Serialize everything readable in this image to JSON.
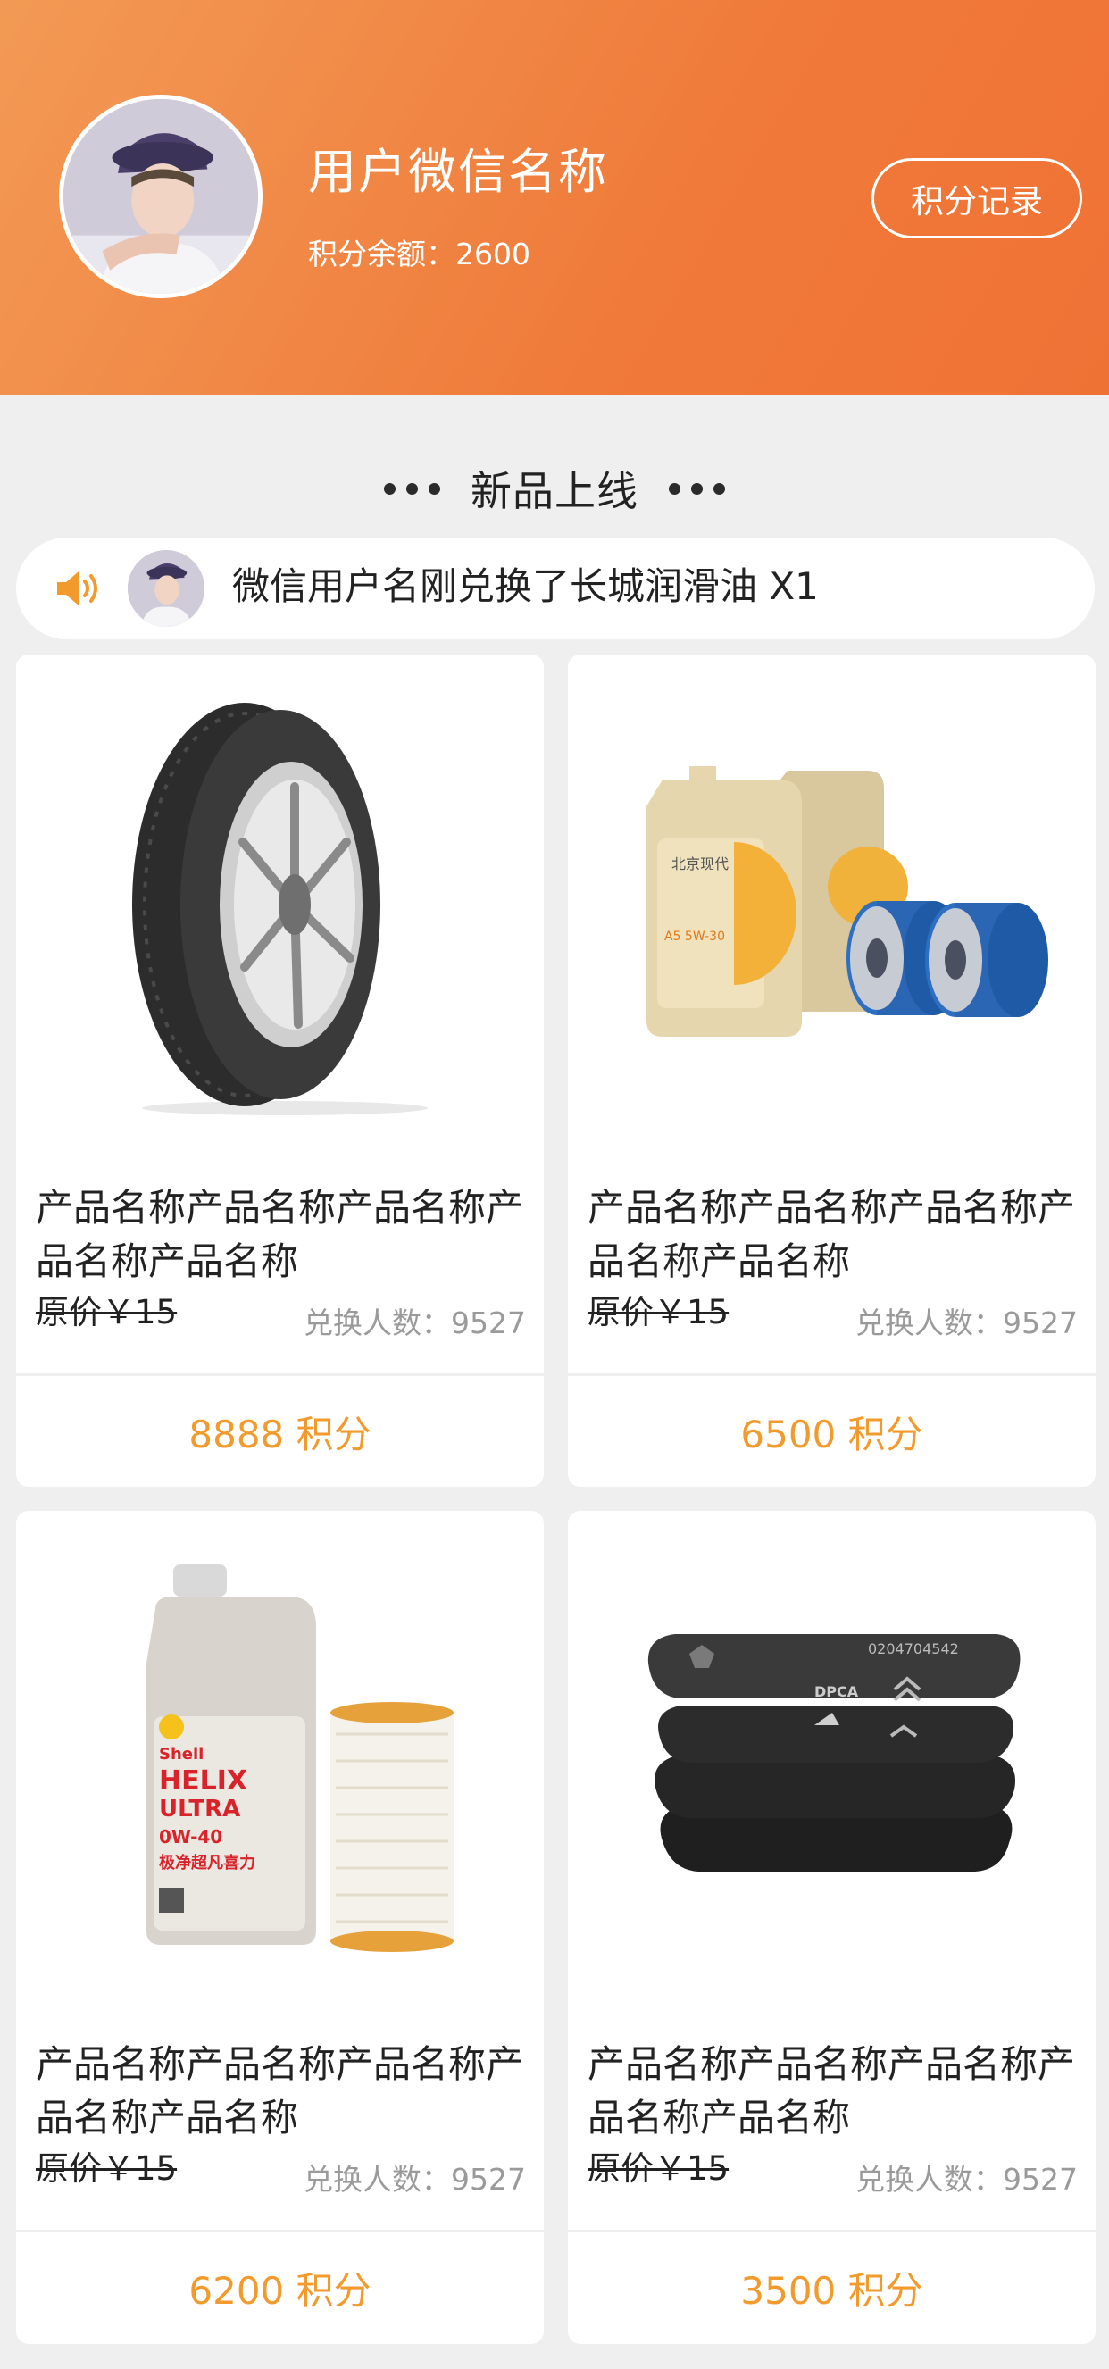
{
  "header": {
    "user_name": "用户微信名称",
    "points_label": "积分余额：",
    "points_value": "2600",
    "records_button": "积分记录"
  },
  "section": {
    "title": "新品上线"
  },
  "ticker": {
    "text": "微信用户名刚兑换了长城润滑油 X1"
  },
  "products": [
    {
      "image": "tire-icon",
      "name": "产品名称产品名称产品名称产品名称产品名称",
      "original_price": "原价￥15",
      "redeem_count": "兑换人数：9527",
      "points_price": "8888 积分"
    },
    {
      "image": "engine-oil-and-filters-icon",
      "name": "产品名称产品名称产品名称产品名称产品名称",
      "original_price": "原价￥15",
      "redeem_count": "兑换人数：9527",
      "points_price": "6500 积分"
    },
    {
      "image": "shell-helix-oil-icon",
      "name": "产品名称产品名称产品名称产品名称产品名称",
      "original_price": "原价￥15",
      "redeem_count": "兑换人数：9527",
      "points_price": "6200 积分"
    },
    {
      "image": "brake-pads-icon",
      "name": "产品名称产品名称产品名称产品名称产品名称",
      "original_price": "原价￥15",
      "redeem_count": "兑换人数：9527",
      "points_price": "3500 积分"
    }
  ],
  "product_labels": {
    "oil_brand_left": "北京现代",
    "oil_grade_left": "A5 5W-30",
    "shell_brand": "Shell",
    "shell_line1": "HELIX",
    "shell_line2": "ULTRA",
    "shell_grade": "0W-40",
    "shell_cn": "极净超凡喜力",
    "brake_code": "0204704542",
    "brake_mark": "DPCA"
  },
  "colors": {
    "header_gradient_start": "#f29a55",
    "header_gradient_end": "#ef7235",
    "accent_orange": "#f29a2c",
    "background": "#efefef"
  }
}
